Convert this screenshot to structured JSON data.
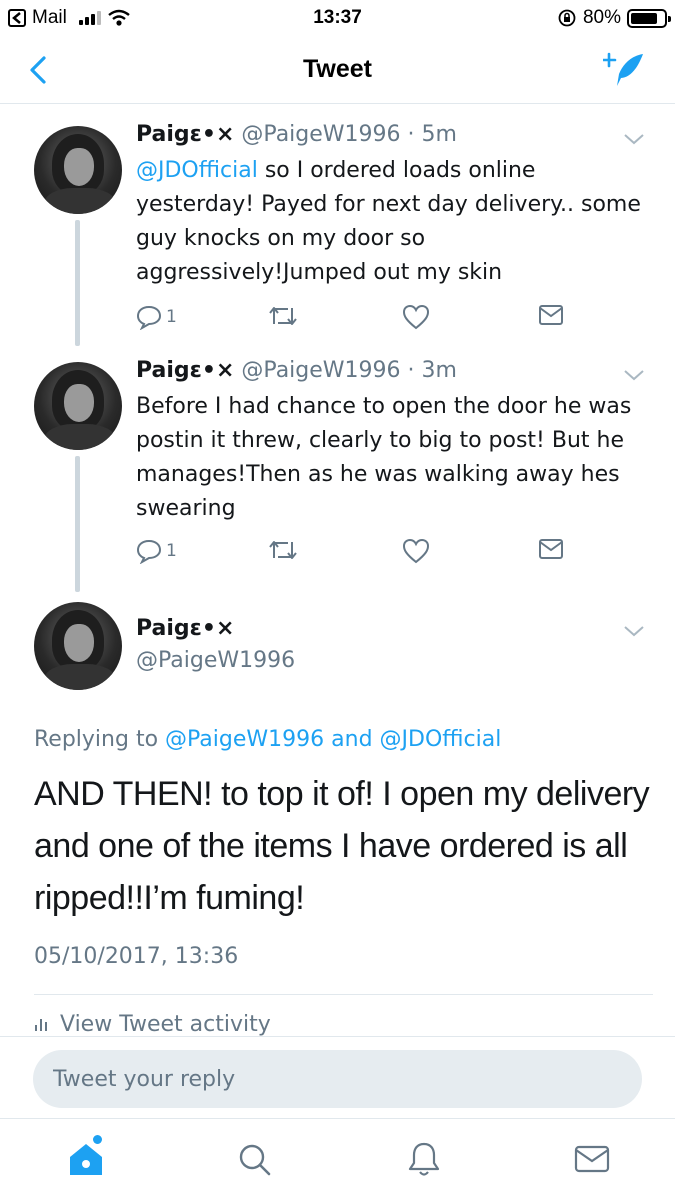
{
  "status_bar": {
    "back_app": "Mail",
    "time": "13:37",
    "battery": "80%",
    "battery_level": 0.8
  },
  "nav": {
    "title": "Tweet",
    "back_icon": "chevron-left-icon",
    "compose_icon": "compose-quill-icon"
  },
  "thread": [
    {
      "display_name": "Paigɛ•×",
      "handle": "@PaigeW1996",
      "time": "· 5m",
      "mention": "@JDOfficial",
      "text": " so I ordered loads online yesterday! Payed for next day delivery.. some guy knocks on my door so aggressively!Jumped out my skin",
      "reply_count": "1"
    },
    {
      "display_name": "Paigɛ•×",
      "handle": "@PaigeW1996",
      "time": "· 3m",
      "text": "Before I had chance to open the door he was postin it threw, clearly to big to post! But he manages!Then as he was walking away hes swearing",
      "reply_count": "1"
    }
  ],
  "main_tweet": {
    "display_name": "Paigɛ•×",
    "handle": "@PaigeW1996",
    "replying_prefix": "Replying to ",
    "replying_to": "@PaigeW1996 and @JDOfficial",
    "text": "AND THEN! to top it of! I open my delivery and one of the items I have ordered is all ripped!!I’m fuming!",
    "timestamp": "05/10/2017, 13:36",
    "activity": "View Tweet activity"
  },
  "reply": {
    "placeholder": "Tweet your reply"
  },
  "tabs": [
    "home-icon",
    "search-icon",
    "notifications-bell-icon",
    "messages-envelope-icon"
  ],
  "colors": {
    "accent": "#1da1f2",
    "secondary_text": "#657786",
    "divider": "#e1e8ed",
    "reply_bg": "#e6ecf0"
  }
}
